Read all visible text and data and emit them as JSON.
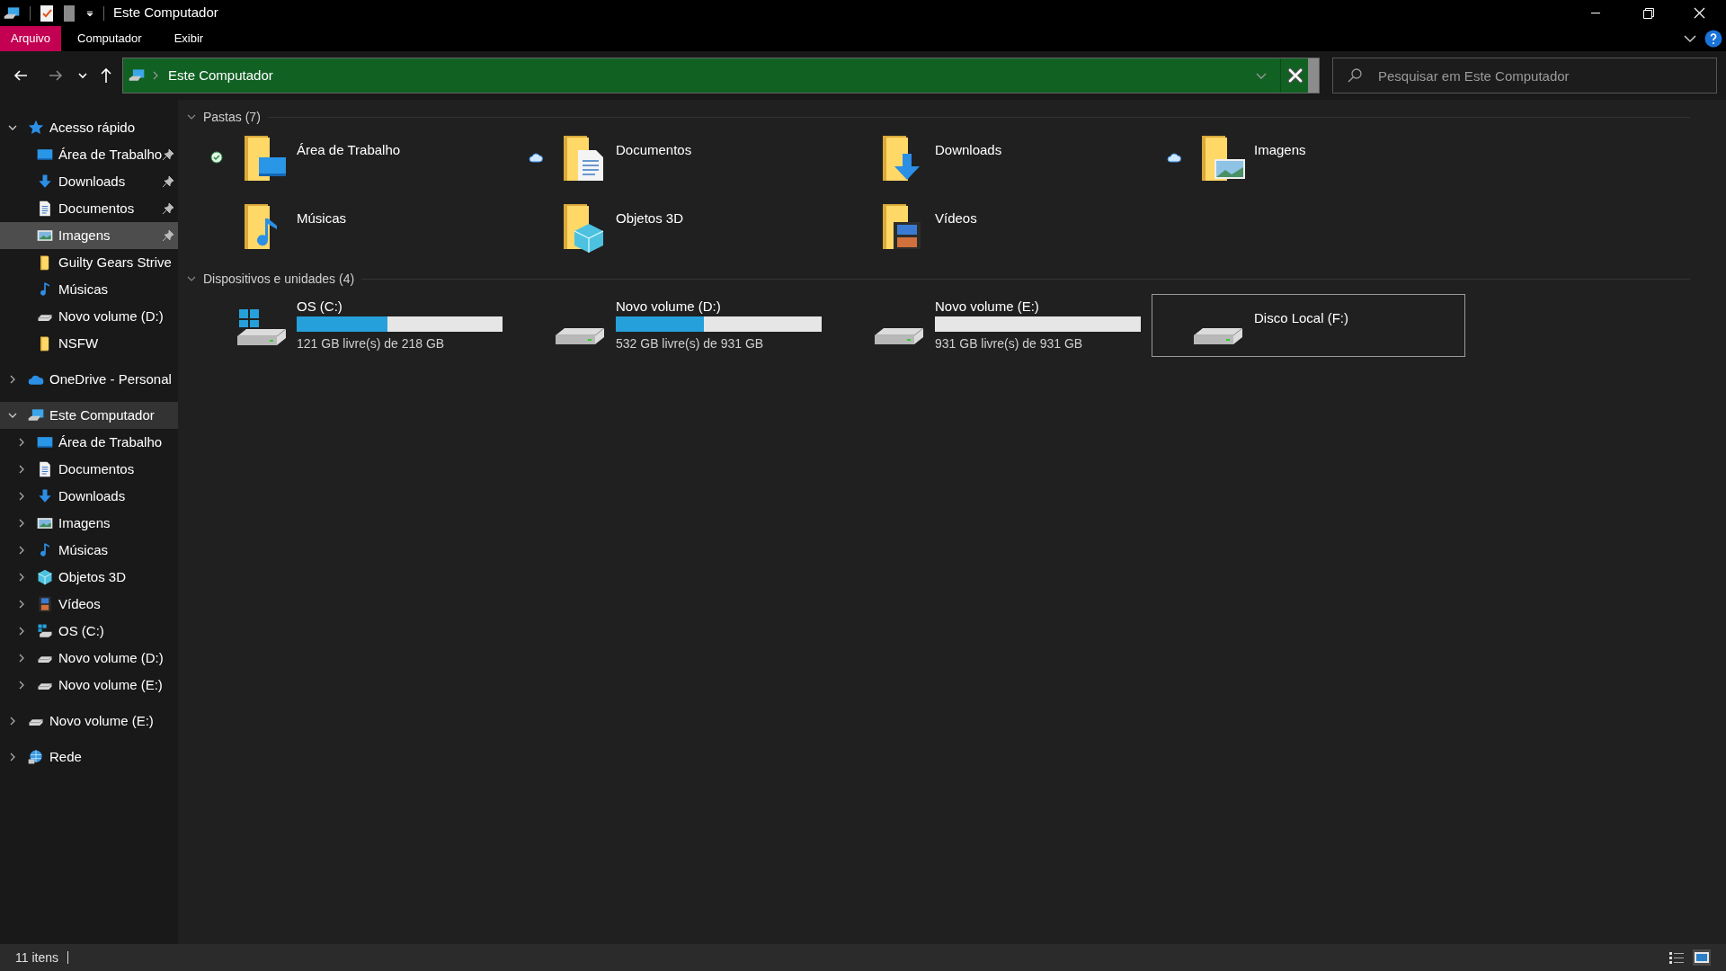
{
  "window": {
    "title": "Este Computador"
  },
  "ribbon_tabs": [
    {
      "label": "Arquivo",
      "selected": true
    },
    {
      "label": "Computador",
      "selected": false
    },
    {
      "label": "Exibir",
      "selected": false
    }
  ],
  "address": {
    "path": "Este Computador"
  },
  "search": {
    "placeholder": "Pesquisar em Este Computador"
  },
  "sidebar": {
    "items": [
      {
        "label": "Acesso rápido",
        "kind": "star",
        "expanded": true,
        "selected": false,
        "current": false,
        "children": [
          {
            "label": "Área de Trabalho",
            "kind": "desktop",
            "pinned": true,
            "selected": false
          },
          {
            "label": "Downloads",
            "kind": "downloads",
            "pinned": true,
            "selected": false
          },
          {
            "label": "Documentos",
            "kind": "documents",
            "pinned": true,
            "selected": false
          },
          {
            "label": "Imagens",
            "kind": "pictures",
            "pinned": true,
            "selected": true
          },
          {
            "label": "Guilty Gears Strive",
            "kind": "folder",
            "pinned": false,
            "selected": false
          },
          {
            "label": "Músicas",
            "kind": "music",
            "pinned": false,
            "selected": false
          },
          {
            "label": "Novo volume (D:)",
            "kind": "drive",
            "pinned": false,
            "selected": false
          },
          {
            "label": "NSFW",
            "kind": "folder",
            "pinned": false,
            "selected": false
          }
        ]
      },
      {
        "label": "OneDrive - Personal",
        "kind": "onedrive",
        "expanded": false,
        "selected": false,
        "current": false
      },
      {
        "label": "Este Computador",
        "kind": "pc",
        "expanded": true,
        "selected": false,
        "current": true,
        "children": [
          {
            "label": "Área de Trabalho",
            "kind": "desktop",
            "expanded": false
          },
          {
            "label": "Documentos",
            "kind": "documents",
            "expanded": false
          },
          {
            "label": "Downloads",
            "kind": "downloads",
            "expanded": false
          },
          {
            "label": "Imagens",
            "kind": "pictures",
            "expanded": false
          },
          {
            "label": "Músicas",
            "kind": "music",
            "expanded": false
          },
          {
            "label": "Objetos 3D",
            "kind": "objects3d",
            "expanded": false
          },
          {
            "label": "Vídeos",
            "kind": "videos",
            "expanded": false
          },
          {
            "label": "OS (C:)",
            "kind": "osdrive",
            "expanded": false
          },
          {
            "label": "Novo volume (D:)",
            "kind": "drive",
            "expanded": false
          },
          {
            "label": "Novo volume (E:)",
            "kind": "drive",
            "expanded": false
          }
        ]
      },
      {
        "label": "Novo volume (E:)",
        "kind": "drive",
        "expanded": false,
        "selected": false,
        "current": false
      },
      {
        "label": "Rede",
        "kind": "network",
        "expanded": false,
        "selected": false,
        "current": false
      }
    ]
  },
  "folders": {
    "header": "Pastas (7)",
    "items": [
      {
        "name": "Área de Trabalho",
        "kind": "desktop",
        "synced": true,
        "online_only": false
      },
      {
        "name": "Documentos",
        "kind": "documents",
        "synced": false,
        "online_only": true
      },
      {
        "name": "Downloads",
        "kind": "downloads",
        "synced": false,
        "online_only": false
      },
      {
        "name": "Imagens",
        "kind": "pictures",
        "synced": false,
        "online_only": true
      },
      {
        "name": "Músicas",
        "kind": "music",
        "synced": false,
        "online_only": false
      },
      {
        "name": "Objetos 3D",
        "kind": "objects3d",
        "synced": false,
        "online_only": false
      },
      {
        "name": "Vídeos",
        "kind": "videos",
        "synced": false,
        "online_only": false
      }
    ]
  },
  "drives": {
    "header": "Dispositivos e unidades (4)",
    "items": [
      {
        "name": "OS (C:)",
        "kind": "osdrive",
        "level": 0.44,
        "free": "121 GB livre(s) de 218 GB",
        "focused": false
      },
      {
        "name": "Novo volume (D:)",
        "kind": "drive",
        "level": 0.43,
        "free": "532 GB livre(s) de 931 GB",
        "focused": false
      },
      {
        "name": "Novo volume (E:)",
        "kind": "drive",
        "level": 0,
        "free": "931 GB livre(s) de 931 GB",
        "focused": false
      },
      {
        "name": "Disco Local (F:)",
        "kind": "drive",
        "focused": true
      }
    ]
  },
  "status_bar": {
    "count": "11 itens",
    "views": [
      {
        "kind": "details",
        "selected": false
      },
      {
        "kind": "large-icons",
        "selected": true
      }
    ]
  }
}
